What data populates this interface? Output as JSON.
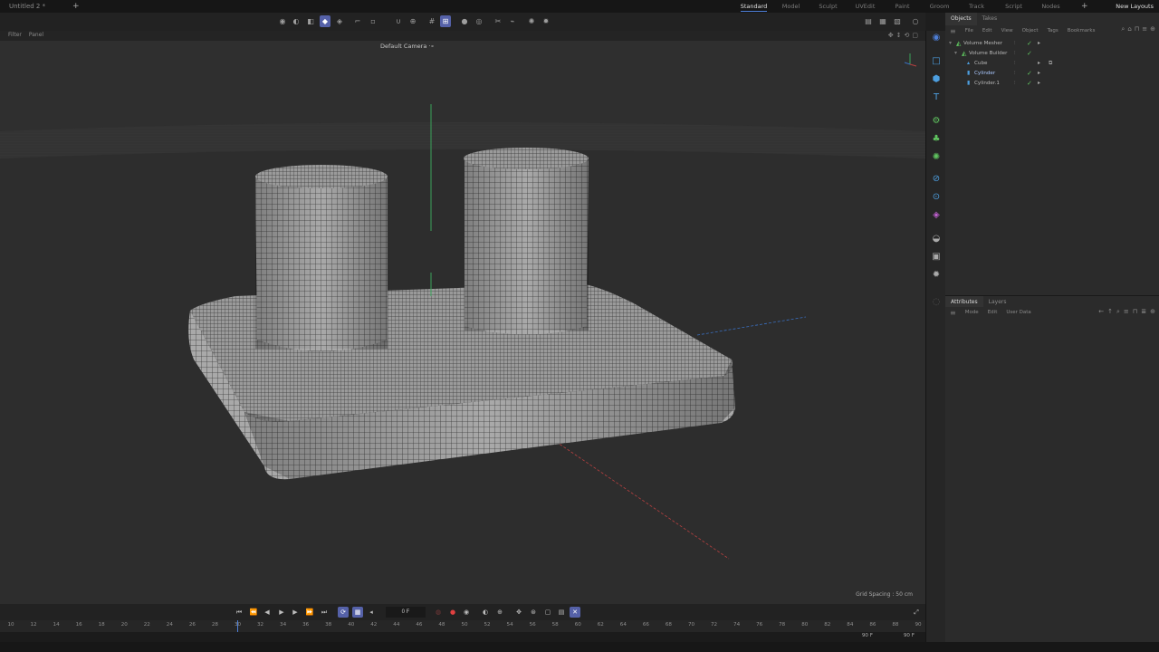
{
  "window": {
    "doc_tab": "Untitled 2 *",
    "add_tab": "+"
  },
  "layouts": {
    "tabs": [
      "Standard",
      "Model",
      "Sculpt",
      "UVEdit",
      "Paint",
      "Groom",
      "Track",
      "Script",
      "Nodes"
    ],
    "active_index": 0,
    "add": "+",
    "new_layouts": "New Layouts"
  },
  "viewport": {
    "menu": [
      "Filter",
      "Panel"
    ],
    "camera_label": "Default Camera ·∘",
    "grid_spacing": "Grid Spacing : 50 cm"
  },
  "objects_panel": {
    "tabs": [
      "Objects",
      "Takes"
    ],
    "menu": [
      "File",
      "Edit",
      "View",
      "Object",
      "Tags",
      "Bookmarks"
    ],
    "tree": [
      {
        "name": "Volume Mesher",
        "depth": 0,
        "icon": "volume-mesher-icon"
      },
      {
        "name": "Volume Builder",
        "depth": 1,
        "icon": "volume-builder-icon"
      },
      {
        "name": "Cube",
        "depth": 2,
        "icon": "cube-icon"
      },
      {
        "name": "Cylinder",
        "depth": 2,
        "icon": "cylinder-icon"
      },
      {
        "name": "Cylinder.1",
        "depth": 2,
        "icon": "cylinder-icon"
      }
    ]
  },
  "attributes_panel": {
    "tabs": [
      "Attributes",
      "Layers"
    ],
    "menu": [
      "Mode",
      "Edit",
      "User Data"
    ]
  },
  "timeline": {
    "current_frame": "0 F",
    "ruler_ticks": [
      "10",
      "12",
      "14",
      "16",
      "18",
      "20",
      "22",
      "24",
      "26",
      "28",
      "30",
      "32",
      "34",
      "36",
      "38",
      "40",
      "42",
      "44",
      "46",
      "48",
      "50",
      "52",
      "54",
      "56",
      "58",
      "60",
      "62",
      "64",
      "66",
      "68",
      "70",
      "72",
      "74",
      "76",
      "78",
      "80",
      "82",
      "84",
      "86",
      "88",
      "90"
    ],
    "range_start": "90 F",
    "range_end": "90 F"
  },
  "colors": {
    "accent": "#5561a8",
    "selection_blue": "#4d7ed6",
    "check_green": "#5fc35f",
    "viewport_bg": "#2f2f2f"
  }
}
